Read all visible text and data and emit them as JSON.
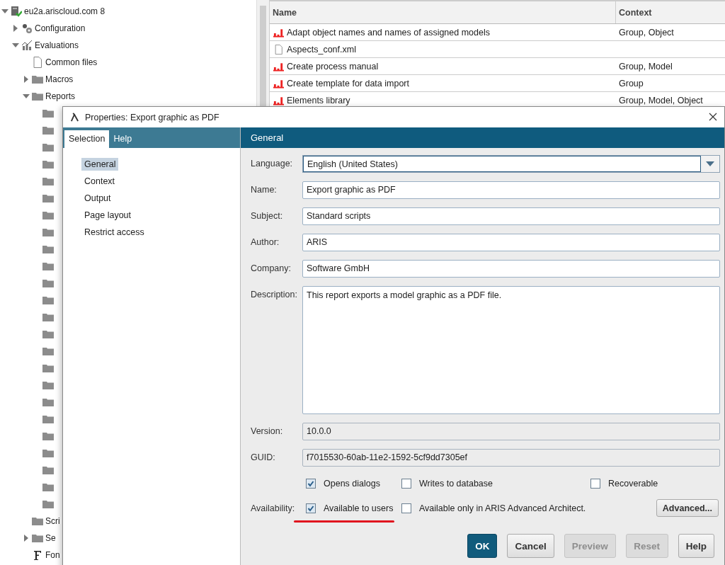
{
  "tree": [
    {
      "label": "eu2a.ariscloud.com 8",
      "kind": "server",
      "expanded": true,
      "children": [
        {
          "label": "Configuration",
          "kind": "gears",
          "expanded": false
        },
        {
          "label": "Evaluations",
          "kind": "chart",
          "expanded": true,
          "children": [
            {
              "label": "Common files",
              "kind": "file"
            },
            {
              "label": "Macros",
              "kind": "folder",
              "expanded": false
            },
            {
              "label": "Reports",
              "kind": "folder",
              "expanded": true,
              "children": [
                {
                  "kind": "folder"
                },
                {
                  "kind": "folder"
                },
                {
                  "kind": "folder"
                },
                {
                  "kind": "folder"
                },
                {
                  "kind": "folder"
                },
                {
                  "kind": "folder"
                },
                {
                  "kind": "folder"
                },
                {
                  "kind": "folder"
                },
                {
                  "kind": "folder"
                },
                {
                  "kind": "folder"
                },
                {
                  "kind": "folder"
                },
                {
                  "kind": "folder"
                },
                {
                  "kind": "folder"
                },
                {
                  "kind": "folder"
                },
                {
                  "kind": "folder"
                },
                {
                  "kind": "folder"
                },
                {
                  "kind": "folder"
                },
                {
                  "kind": "folder"
                },
                {
                  "kind": "folder"
                },
                {
                  "kind": "folder"
                },
                {
                  "kind": "folder"
                },
                {
                  "kind": "folder"
                },
                {
                  "kind": "folder"
                },
                {
                  "kind": "folder"
                }
              ]
            },
            {
              "label": "Scri",
              "kind": "folder"
            },
            {
              "label": "Se",
              "kind": "folder",
              "expanded": false
            },
            {
              "label": "Fon",
              "kind": "font"
            }
          ]
        }
      ]
    }
  ],
  "table": {
    "columns": [
      "Name",
      "Context"
    ],
    "rows": [
      {
        "kind": "report",
        "name": "Adapt object names and names of assigned models",
        "context": "Group, Object"
      },
      {
        "kind": "file",
        "name": "Aspects_conf.xml",
        "context": ""
      },
      {
        "kind": "report",
        "name": "Create process manual",
        "context": "Group, Model"
      },
      {
        "kind": "report",
        "name": "Create template for data import",
        "context": "Group"
      },
      {
        "kind": "report",
        "name": "Elements library",
        "context": "Group, Model, Object"
      }
    ]
  },
  "dialog": {
    "title": "Properties: Export graphic as PDF",
    "tabs": [
      {
        "label": "Selection",
        "selected": true
      },
      {
        "label": "Help",
        "selected": false
      }
    ],
    "nav": [
      {
        "label": "General",
        "selected": true
      },
      {
        "label": "Context",
        "selected": false
      },
      {
        "label": "Output",
        "selected": false
      },
      {
        "label": "Page layout",
        "selected": false
      },
      {
        "label": "Restrict access",
        "selected": false
      }
    ],
    "section": "General",
    "fields": [
      {
        "label": "Language:",
        "value": "English (United States)",
        "kind": "dropdown"
      },
      {
        "label": "Name:",
        "value": "Export graphic as PDF",
        "kind": "text"
      },
      {
        "label": "Subject:",
        "value": "Standard scripts",
        "kind": "text"
      },
      {
        "label": "Author:",
        "value": "ARIS",
        "kind": "text"
      },
      {
        "label": "Company:",
        "value": "Software GmbH",
        "kind": "text"
      },
      {
        "label": "Description:",
        "value": "This report exports a model graphic as a PDF file.",
        "kind": "textarea"
      },
      {
        "label": "Version:",
        "value": "10.0.0",
        "kind": "readonly"
      },
      {
        "label": "GUID:",
        "value": "f7015530-60ab-11e2-1592-5cf9dd7305ef",
        "kind": "readonly"
      }
    ],
    "options": [
      {
        "label": "Opens dialogs",
        "checked": true
      },
      {
        "label": "Writes to database",
        "checked": false
      },
      {
        "label": "Recoverable",
        "checked": false
      }
    ],
    "availability": {
      "label": "Availability:",
      "options": [
        {
          "label": "Available to users",
          "checked": true
        },
        {
          "label": "Available only in ARIS Advanced Architect.",
          "checked": false
        }
      ],
      "button": "Advanced..."
    },
    "buttons": [
      {
        "label": "OK",
        "kind": "primary",
        "disabled": false
      },
      {
        "label": "Cancel",
        "kind": "normal",
        "disabled": false
      },
      {
        "label": "Preview",
        "kind": "normal",
        "disabled": true
      },
      {
        "label": "Reset",
        "kind": "normal",
        "disabled": true
      },
      {
        "label": "Help",
        "kind": "normal",
        "disabled": false
      }
    ]
  }
}
